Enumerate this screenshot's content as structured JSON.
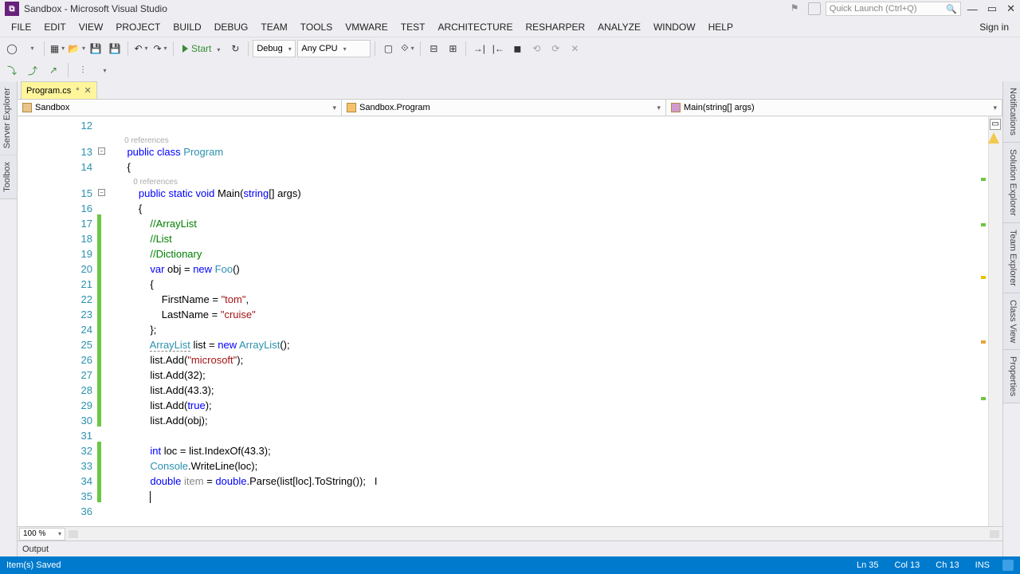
{
  "window": {
    "title": "Sandbox - Microsoft Visual Studio"
  },
  "quicklaunch": {
    "placeholder": "Quick Launch (Ctrl+Q)"
  },
  "menu": [
    "FILE",
    "EDIT",
    "VIEW",
    "PROJECT",
    "BUILD",
    "DEBUG",
    "TEAM",
    "TOOLS",
    "VMWARE",
    "TEST",
    "ARCHITECTURE",
    "RESHARPER",
    "ANALYZE",
    "WINDOW",
    "HELP"
  ],
  "signin": "Sign in",
  "toolbar": {
    "start": "Start",
    "config": "Debug",
    "platform": "Any CPU"
  },
  "left_rail": [
    "Server Explorer",
    "Toolbox"
  ],
  "right_rail": [
    "Notifications",
    "Solution Explorer",
    "Team Explorer",
    "Class View",
    "Properties"
  ],
  "doctab": {
    "name": "Program.cs",
    "dirty": "*"
  },
  "nav": {
    "scope": "Sandbox",
    "type": "Sandbox.Program",
    "member": "Main(string[] args)"
  },
  "zoom": "100 %",
  "output_label": "Output",
  "status": {
    "message": "Item(s) Saved",
    "line": "Ln 35",
    "col": "Col 13",
    "ch": "Ch 13",
    "ins": "INS"
  },
  "ref0": "0 references",
  "code": {
    "lines": [
      {
        "n": 12,
        "h": ""
      },
      {
        "n": 13,
        "fold": true,
        "h": "    <span class='kw'>public</span> <span class='kw'>class</span> <span class='type'>Program</span>",
        "pre": "    <span class='refs'>0 references</span>"
      },
      {
        "n": 14,
        "h": "    {"
      },
      {
        "n": 15,
        "fold": true,
        "h": "        <span class='kw'>public</span> <span class='kw'>static</span> <span class='kw'>void</span> Main(<span class='kw'>string</span>[] args)",
        "pre": "        <span class='refs'>0 references</span>"
      },
      {
        "n": 16,
        "h": "        {"
      },
      {
        "n": 17,
        "g": true,
        "h": "            <span class='cm'>//ArrayList</span>"
      },
      {
        "n": 18,
        "g": true,
        "h": "            <span class='cm'>//List</span>"
      },
      {
        "n": 19,
        "g": true,
        "h": "            <span class='cm'>//Dictionary</span>"
      },
      {
        "n": 20,
        "g": true,
        "h": "            <span class='kw'>var</span> obj = <span class='kw'>new</span> <span class='type'>Foo</span>()"
      },
      {
        "n": 21,
        "g": true,
        "h": "            {"
      },
      {
        "n": 22,
        "g": true,
        "h": "                FirstName = <span class='str'>\"tom\"</span>,"
      },
      {
        "n": 23,
        "g": true,
        "h": "                LastName = <span class='str'>\"cruise\"</span>"
      },
      {
        "n": 24,
        "g": true,
        "h": "            };"
      },
      {
        "n": 25,
        "g": true,
        "h": "            <span class='type underline'>ArrayList</span> list = <span class='kw'>new</span> <span class='type'>ArrayList</span>();"
      },
      {
        "n": 26,
        "g": true,
        "h": "            list.Add(<span class='str'>\"microsoft\"</span>);"
      },
      {
        "n": 27,
        "g": true,
        "h": "            list.Add(32);"
      },
      {
        "n": 28,
        "g": true,
        "h": "            list.Add(43.3);"
      },
      {
        "n": 29,
        "g": true,
        "h": "            list.Add(<span class='kw'>true</span>);"
      },
      {
        "n": 30,
        "g": true,
        "h": "            list.Add(obj);"
      },
      {
        "n": 31,
        "h": ""
      },
      {
        "n": 32,
        "g": true,
        "h": "            <span class='kw'>int</span> loc = list.IndexOf(43.3);"
      },
      {
        "n": 33,
        "g": true,
        "h": "            <span class='type'>Console</span>.WriteLine(loc);"
      },
      {
        "n": 34,
        "g": true,
        "h": "            <span class='kw'>double</span> <span class='pale'>item</span> = <span class='kw'>double</span>.Parse(list[loc].ToString());   <span style='color:#000'>I</span>"
      },
      {
        "n": 35,
        "g": true,
        "h": "            <span class='cursor'></span>"
      },
      {
        "n": 36,
        "h": ""
      }
    ]
  }
}
